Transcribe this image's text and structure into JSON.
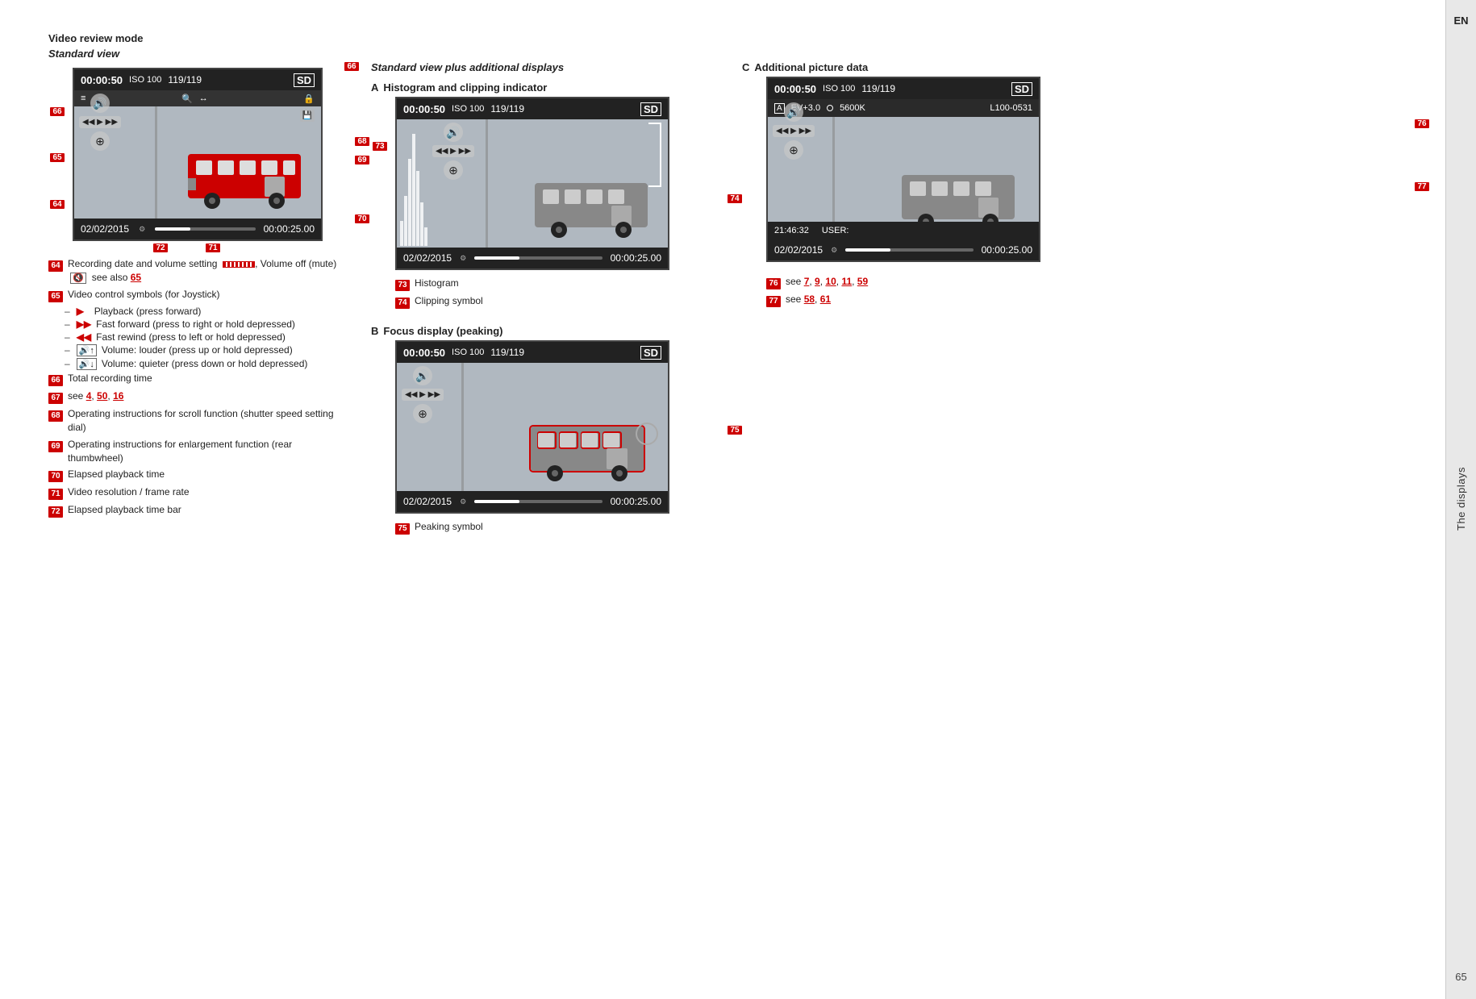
{
  "page": {
    "page_number": "65",
    "sidebar_en": "EN",
    "sidebar_displays": "The displays"
  },
  "left_col": {
    "section_title": "Video review mode",
    "section_subtitle": "Standard view",
    "screen": {
      "time": "00:00:50",
      "iso": "ISO 100",
      "frames": "119/119",
      "sd": "SD",
      "date": "02/02/2015",
      "elapsed": "00:00:25.00"
    },
    "annotations": [
      {
        "id": "64",
        "text": "Recording date and volume setting",
        "extra": ", Volume off (mute)",
        "see_also": "65"
      },
      {
        "id": "65",
        "text": "Video control symbols (for Joystick)"
      },
      {
        "id": "65_sub1",
        "dash": true,
        "symbol": "▶",
        "text": "Playback (press forward)"
      },
      {
        "id": "65_sub2",
        "dash": true,
        "symbol": "▶▶",
        "text": "Fast forward (press to right or hold depressed)"
      },
      {
        "id": "65_sub3",
        "dash": true,
        "symbol": "◀◀",
        "text": "Fast rewind (press to left or hold depressed)"
      },
      {
        "id": "65_sub4",
        "dash": true,
        "symbol": "🔊+",
        "text": "Volume: louder (press up or hold depressed)"
      },
      {
        "id": "65_sub5",
        "dash": true,
        "symbol": "🔊-",
        "text": "Volume: quieter (press down or hold depressed)"
      },
      {
        "id": "66",
        "text": "Total recording time"
      },
      {
        "id": "67",
        "text": "see",
        "refs": [
          "4",
          "50",
          "16"
        ]
      },
      {
        "id": "68",
        "text": "Operating instructions for scroll function (shutter speed setting dial)"
      },
      {
        "id": "69",
        "text": "Operating instructions for enlargement function (rear thumbwheel)"
      },
      {
        "id": "70",
        "text": "Elapsed playback time"
      },
      {
        "id": "71",
        "text": "Video resolution / frame rate"
      },
      {
        "id": "72",
        "text": "Elapsed playback time bar"
      }
    ]
  },
  "mid_col": {
    "section_subtitle": "Standard view plus additional displays",
    "section_a_label": "A",
    "section_a_text": "Histogram and clipping indicator",
    "section_b_label": "B",
    "section_b_text": "Focus display (peaking)",
    "screen_a": {
      "time": "00:00:50",
      "iso": "ISO 100",
      "frames": "119/119",
      "sd": "SD",
      "date": "02/02/2015",
      "elapsed": "00:00:25.00"
    },
    "screen_b": {
      "time": "00:00:50",
      "iso": "ISO 100",
      "frames": "119/119",
      "sd": "SD",
      "date": "02/02/2015",
      "elapsed": "00:00:25.00"
    },
    "annotation_73": {
      "id": "73",
      "text": "Histogram"
    },
    "annotation_74": {
      "id": "74",
      "text": "Clipping symbol"
    },
    "annotation_75": {
      "id": "75",
      "text": "Peaking symbol"
    }
  },
  "right_col": {
    "section_c_label": "C",
    "section_c_text": "Additional picture data",
    "screen_c": {
      "time": "00:00:50",
      "iso": "ISO 100",
      "frames": "119/119",
      "sd": "SD",
      "ev": "EV+3.0",
      "wb": "5600K",
      "size": "L100-0531",
      "time2": "21:46:32",
      "user": "USER:",
      "date": "02/02/2015",
      "elapsed": "00:00:25.00"
    },
    "annotation_76": {
      "id": "76",
      "text": "see",
      "refs": [
        "7",
        "9",
        "10",
        "11",
        "59"
      ]
    },
    "annotation_77": {
      "id": "77",
      "text": "see",
      "refs": [
        "58",
        "61"
      ]
    }
  }
}
